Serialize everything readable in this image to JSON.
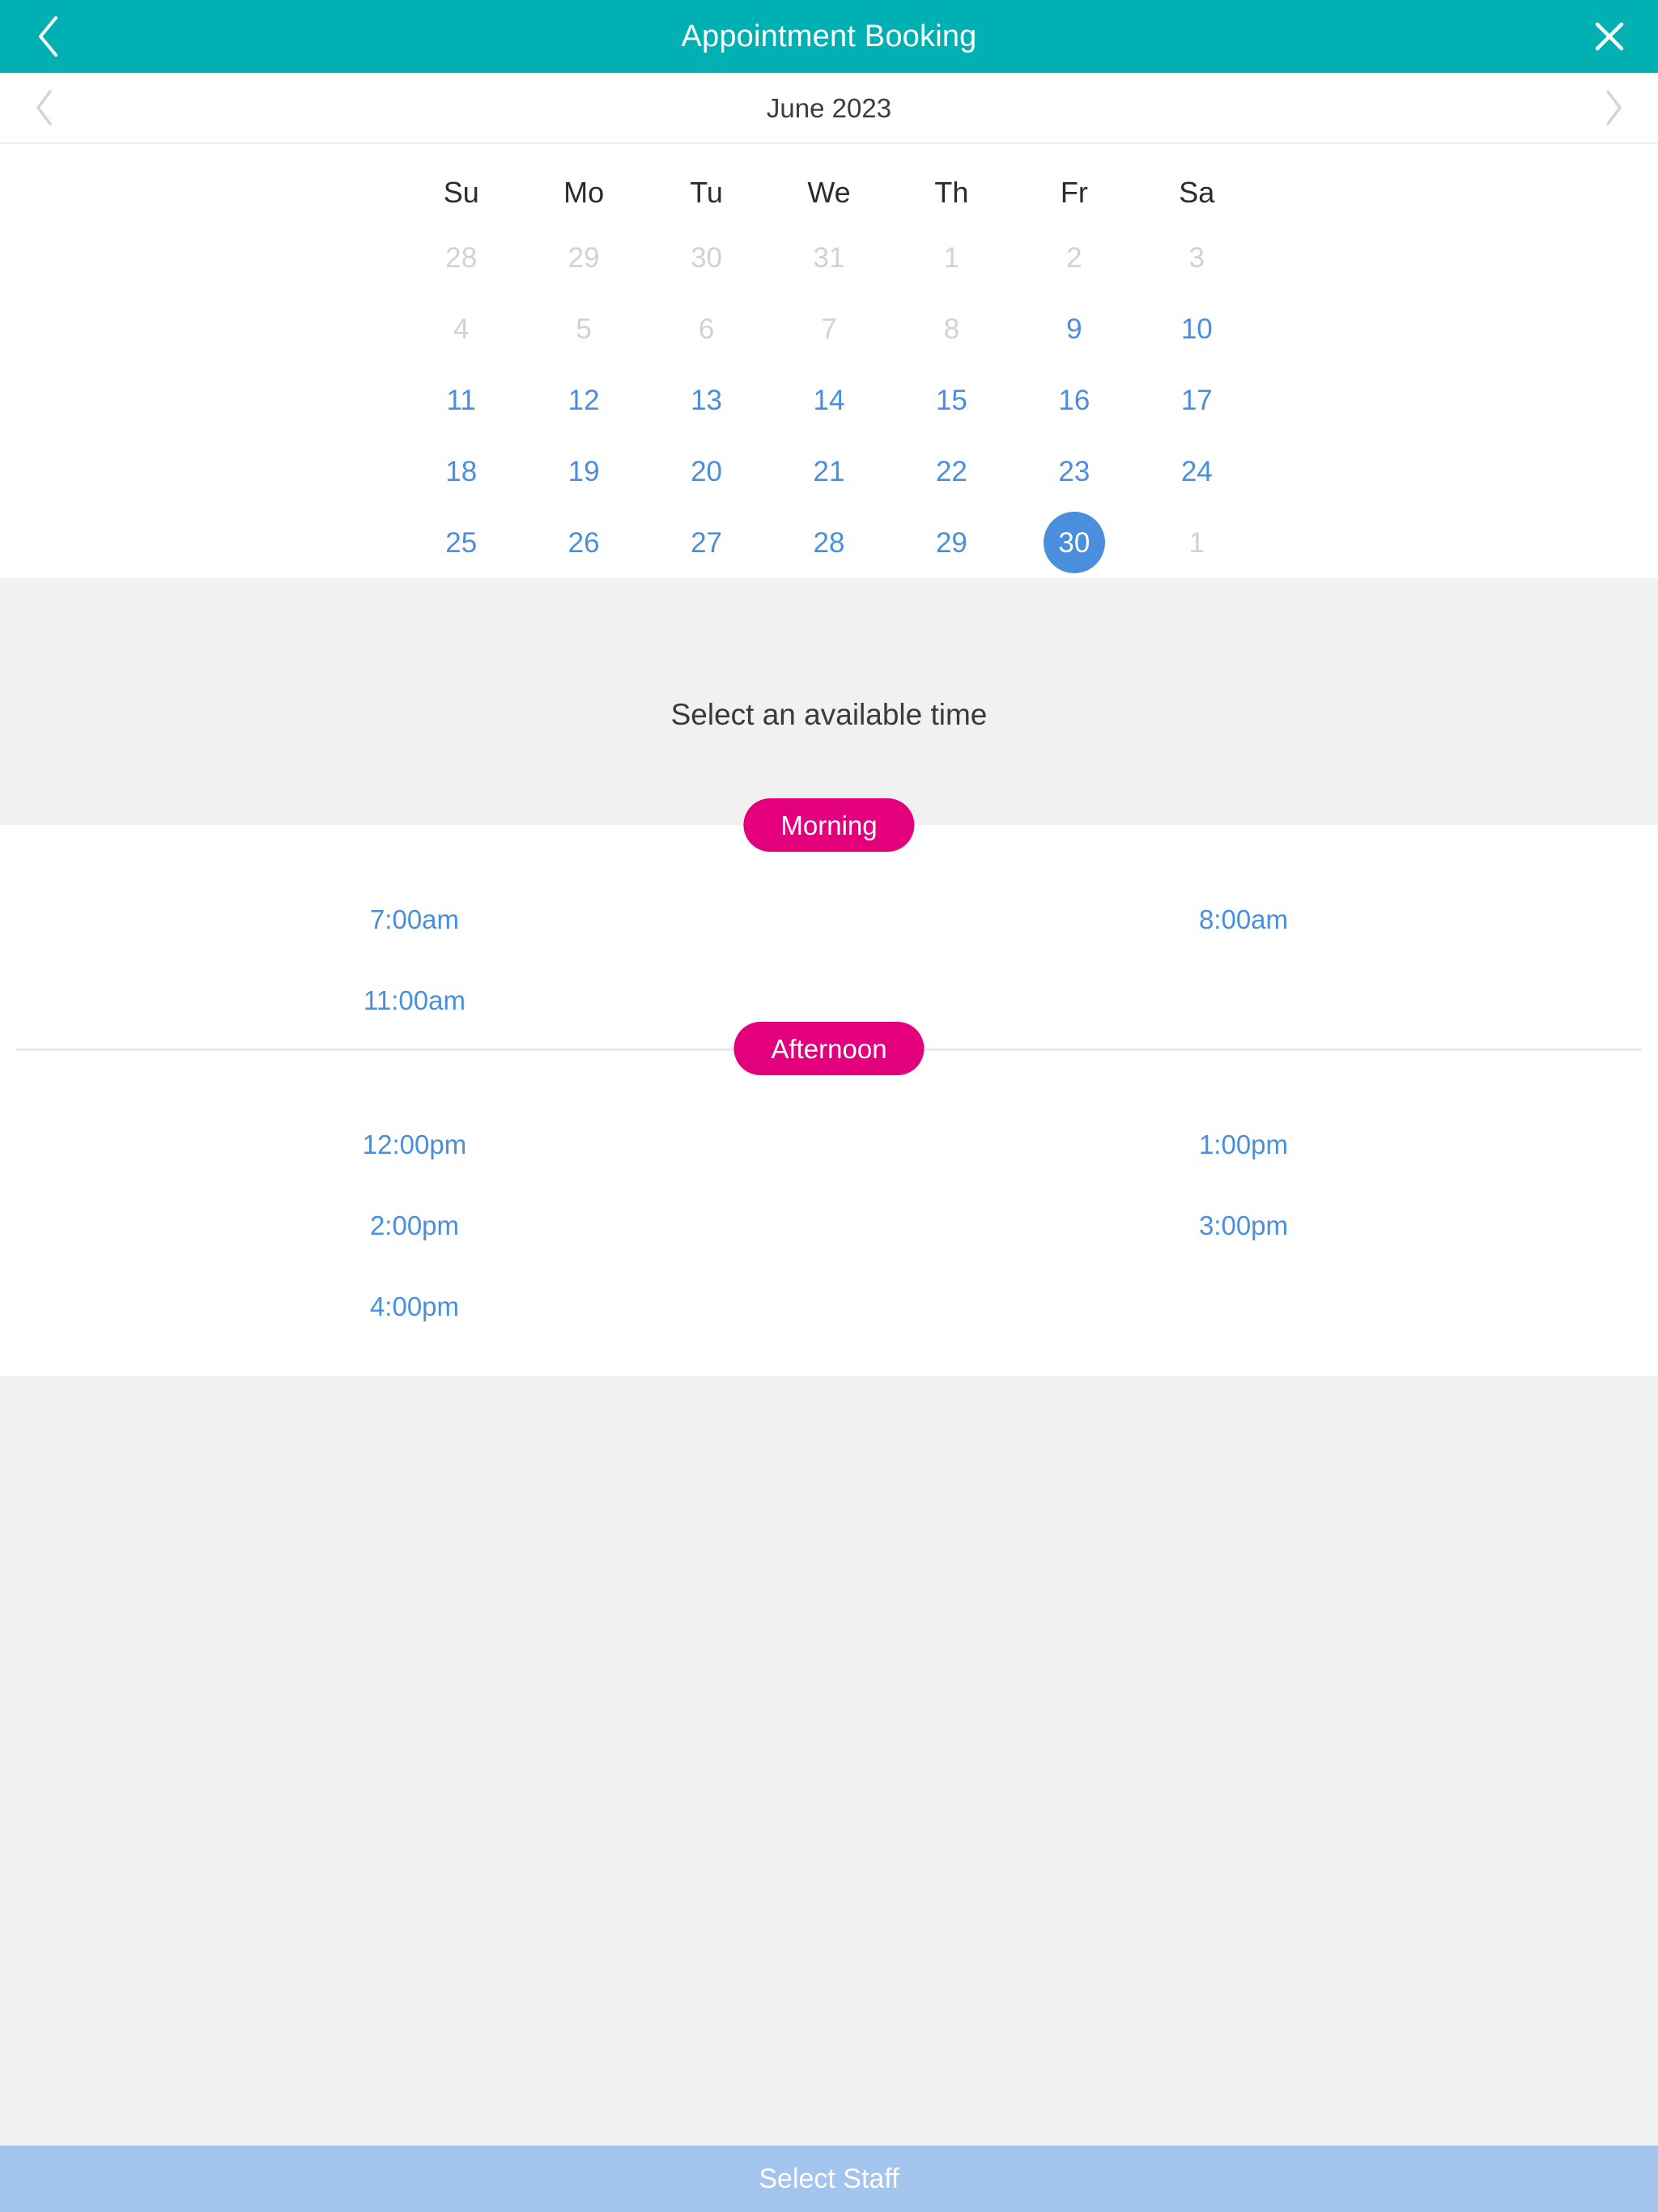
{
  "theme": {
    "teal": "#00b0b2",
    "pink": "#e4007d",
    "blue_link": "#4a8fdd",
    "blue_button": "#a3c4ec",
    "grey_band": "#f1f1f2",
    "muted_text": "#cfd2d6"
  },
  "titlebar": {
    "title": "Appointment Booking",
    "back_icon": "chevron-left-icon",
    "close_icon": "close-icon"
  },
  "month_nav": {
    "label": "June 2023",
    "prev_icon": "chevron-left-icon",
    "next_icon": "chevron-right-icon"
  },
  "calendar": {
    "weekdays": [
      "Su",
      "Mo",
      "Tu",
      "We",
      "Th",
      "Fr",
      "Sa"
    ],
    "selected_day": "30",
    "weeks": [
      [
        {
          "label": "28",
          "state": "muted"
        },
        {
          "label": "29",
          "state": "muted"
        },
        {
          "label": "30",
          "state": "muted"
        },
        {
          "label": "31",
          "state": "muted"
        },
        {
          "label": "1",
          "state": "muted"
        },
        {
          "label": "2",
          "state": "muted"
        },
        {
          "label": "3",
          "state": "muted"
        }
      ],
      [
        {
          "label": "4",
          "state": "muted"
        },
        {
          "label": "5",
          "state": "muted"
        },
        {
          "label": "6",
          "state": "muted"
        },
        {
          "label": "7",
          "state": "muted"
        },
        {
          "label": "8",
          "state": "muted"
        },
        {
          "label": "9",
          "state": "available"
        },
        {
          "label": "10",
          "state": "available"
        }
      ],
      [
        {
          "label": "11",
          "state": "available"
        },
        {
          "label": "12",
          "state": "available"
        },
        {
          "label": "13",
          "state": "available"
        },
        {
          "label": "14",
          "state": "available"
        },
        {
          "label": "15",
          "state": "available"
        },
        {
          "label": "16",
          "state": "available"
        },
        {
          "label": "17",
          "state": "available"
        }
      ],
      [
        {
          "label": "18",
          "state": "available"
        },
        {
          "label": "19",
          "state": "available"
        },
        {
          "label": "20",
          "state": "available"
        },
        {
          "label": "21",
          "state": "available"
        },
        {
          "label": "22",
          "state": "available"
        },
        {
          "label": "23",
          "state": "available"
        },
        {
          "label": "24",
          "state": "available"
        }
      ],
      [
        {
          "label": "25",
          "state": "available"
        },
        {
          "label": "26",
          "state": "available"
        },
        {
          "label": "27",
          "state": "available"
        },
        {
          "label": "28",
          "state": "available"
        },
        {
          "label": "29",
          "state": "available"
        },
        {
          "label": "30",
          "state": "selected"
        },
        {
          "label": "1",
          "state": "muted"
        }
      ]
    ]
  },
  "time_section": {
    "heading": "Select an available time",
    "morning": {
      "pill_label": "Morning",
      "rows": [
        [
          "7:00am",
          "8:00am"
        ],
        [
          "11:00am",
          ""
        ]
      ]
    },
    "afternoon": {
      "pill_label": "Afternoon",
      "rows": [
        [
          "12:00pm",
          "1:00pm"
        ],
        [
          "2:00pm",
          "3:00pm"
        ],
        [
          "4:00pm",
          ""
        ]
      ]
    }
  },
  "bottom_bar": {
    "label": "Select Staff"
  }
}
